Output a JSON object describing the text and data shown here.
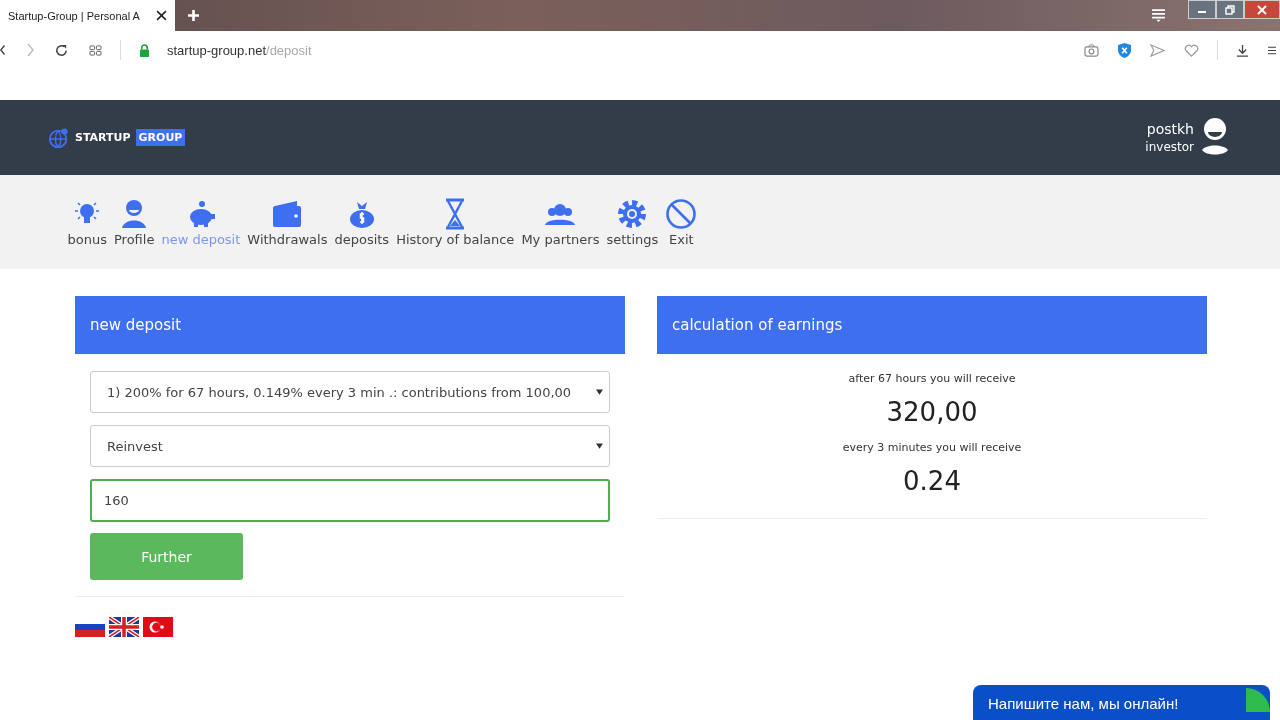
{
  "browser": {
    "tab_title": "Startup-Group | Personal A",
    "url_host": "startup-group.net",
    "url_path": "/deposit"
  },
  "header": {
    "logo_primary": "STARTUP",
    "logo_secondary": "GROUP",
    "username": "postkh",
    "role": "investor"
  },
  "nav": [
    {
      "label": "bonus",
      "selected": false
    },
    {
      "label": "Profile",
      "selected": false
    },
    {
      "label": "new deposit",
      "selected": true
    },
    {
      "label": "Withdrawals",
      "selected": false
    },
    {
      "label": "deposits",
      "selected": false
    },
    {
      "label": "History of balance",
      "selected": false
    },
    {
      "label": "My partners",
      "selected": false
    },
    {
      "label": "settings",
      "selected": false
    },
    {
      "label": "Exit",
      "selected": false
    }
  ],
  "deposit_form": {
    "title": "new deposit",
    "plan": "1) 200% for 67 hours, 0.149% every 3 min .: contributions from 100,00",
    "mode": "Reinvest",
    "amount": "160",
    "submit": "Further"
  },
  "calculation": {
    "title": "calculation of earnings",
    "total_caption": "after 67 hours you will receive",
    "total": "320,00",
    "per_interval_caption": "every 3 minutes you will receive",
    "per_interval": "0.24"
  },
  "chat_widget": {
    "text": "Напишите нам, мы онлайн!"
  }
}
